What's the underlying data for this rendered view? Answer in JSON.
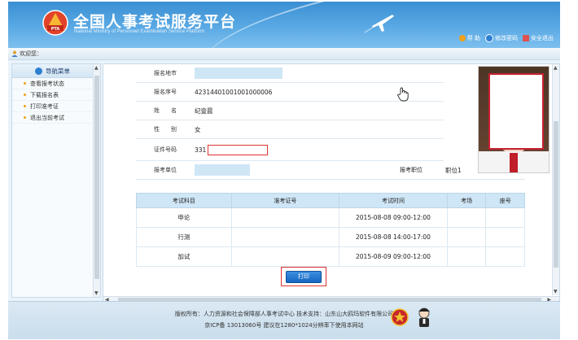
{
  "header": {
    "title": "全国人事考试服务平台",
    "subtitle": "National Ministry of Personnel Examination Service Platform",
    "logo_text": "PTA",
    "links": [
      {
        "label": "帮 助",
        "icon": "help-icon"
      },
      {
        "label": "修改密码",
        "icon": "key-icon"
      },
      {
        "label": "安全退出",
        "icon": "exit-icon"
      }
    ]
  },
  "welcome": {
    "text": "欢迎您："
  },
  "sidebar": {
    "title": "导航菜单",
    "items": [
      {
        "label": "查看报考状态"
      },
      {
        "label": "下载报名表"
      },
      {
        "label": "打印准考证"
      },
      {
        "label": "退出当前考试"
      }
    ]
  },
  "info": {
    "rows": [
      {
        "label": "报名地市",
        "value": ""
      },
      {
        "label": "报名序号",
        "value": "42314401001001000006"
      },
      {
        "label": "姓　　名",
        "value": "纪壹晨"
      },
      {
        "label": "性　　别",
        "value": "女"
      },
      {
        "label": "证件号码",
        "value": "331"
      },
      {
        "label": "报考单位",
        "value": ""
      }
    ],
    "position_label": "报考职位",
    "position_value": "职位1"
  },
  "exam_table": {
    "headers": [
      "考试科目",
      "准考证号",
      "考试时间",
      "考场",
      "座号"
    ],
    "rows": [
      [
        "申论",
        "",
        "2015-08-08 09:00-12:00",
        "",
        ""
      ],
      [
        "行测",
        "",
        "2015-08-08 14:00-17:00",
        "",
        ""
      ],
      [
        "加试",
        "",
        "2015-08-09 09:00-12:00",
        "",
        ""
      ]
    ]
  },
  "print_button": {
    "label": "打印"
  },
  "footer": {
    "line1": "版权所有：人力资源和社会保障部人事考试中心  技术支持：山东山大鸥玛软件有限公司",
    "line2": "京ICP备 13013060号  建议在1280*1024分辨率下使用本网站"
  },
  "colors": {
    "header_blue": "#3a8fd2",
    "accent_red": "#d33333",
    "field_blue": "#cfe6f6"
  }
}
